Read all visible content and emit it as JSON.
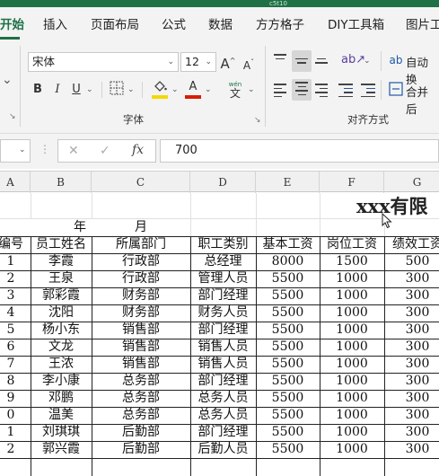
{
  "app": {
    "accent": "#1e7145",
    "title_fragment": "c5t10"
  },
  "tabs": [
    {
      "label": "开始",
      "active": true
    },
    {
      "label": "插入"
    },
    {
      "label": "页面布局"
    },
    {
      "label": "公式"
    },
    {
      "label": "数据"
    },
    {
      "label": "方方格子"
    },
    {
      "label": "DIY工具箱"
    },
    {
      "label": "图片工"
    }
  ],
  "ribbon": {
    "font_name": "宋体",
    "font_size": "12",
    "grow_font": "A",
    "shrink_font": "A",
    "bold": "B",
    "italic": "I",
    "underline": "U",
    "font_color_letter": "A",
    "phonetic": "wén",
    "font_group_label": "字体",
    "align_group_label": "对齐方式",
    "wrap_text": "自动换",
    "merge_center": "合并后",
    "highlight_color": "#f5d800",
    "font_color": "#d81e06"
  },
  "formula_bar": {
    "fx": "fx",
    "cancel": "✕",
    "enter": "✓",
    "value": "700"
  },
  "columns": [
    "A",
    "B",
    "C",
    "D",
    "E",
    "F",
    "G"
  ],
  "sheet": {
    "title": "xxx有限",
    "date_year": "年",
    "date_month": "月",
    "headers": [
      "编号",
      "员工姓名",
      "所属部门",
      "职工类别",
      "基本工资",
      "岗位工资",
      "绩效工资"
    ],
    "rows": [
      [
        "1",
        "李霞",
        "行政部",
        "总经理",
        "8000",
        "1500",
        "500"
      ],
      [
        "2",
        "王泉",
        "行政部",
        "管理人员",
        "5500",
        "1000",
        "300"
      ],
      [
        "3",
        "郭彩霞",
        "财务部",
        "部门经理",
        "5500",
        "1000",
        "300"
      ],
      [
        "4",
        "沈阳",
        "财务部",
        "财务人员",
        "5500",
        "1000",
        "300"
      ],
      [
        "5",
        "杨小东",
        "销售部",
        "部门经理",
        "5500",
        "1000",
        "300"
      ],
      [
        "6",
        "文龙",
        "销售部",
        "销售人员",
        "5500",
        "1000",
        "300"
      ],
      [
        "7",
        "王浓",
        "销售部",
        "销售人员",
        "5500",
        "1000",
        "300"
      ],
      [
        "8",
        "李小康",
        "总务部",
        "部门经理",
        "5500",
        "1000",
        "300"
      ],
      [
        "9",
        "邓鹏",
        "总务部",
        "总务人员",
        "5500",
        "1000",
        "300"
      ],
      [
        "0",
        "温美",
        "总务部",
        "总务人员",
        "5500",
        "1000",
        "300"
      ],
      [
        "1",
        "刘琪琪",
        "后勤部",
        "部门经理",
        "5500",
        "1000",
        "300"
      ],
      [
        "2",
        "郭兴霞",
        "后勤部",
        "后勤人员",
        "5500",
        "1000",
        "300"
      ]
    ]
  }
}
